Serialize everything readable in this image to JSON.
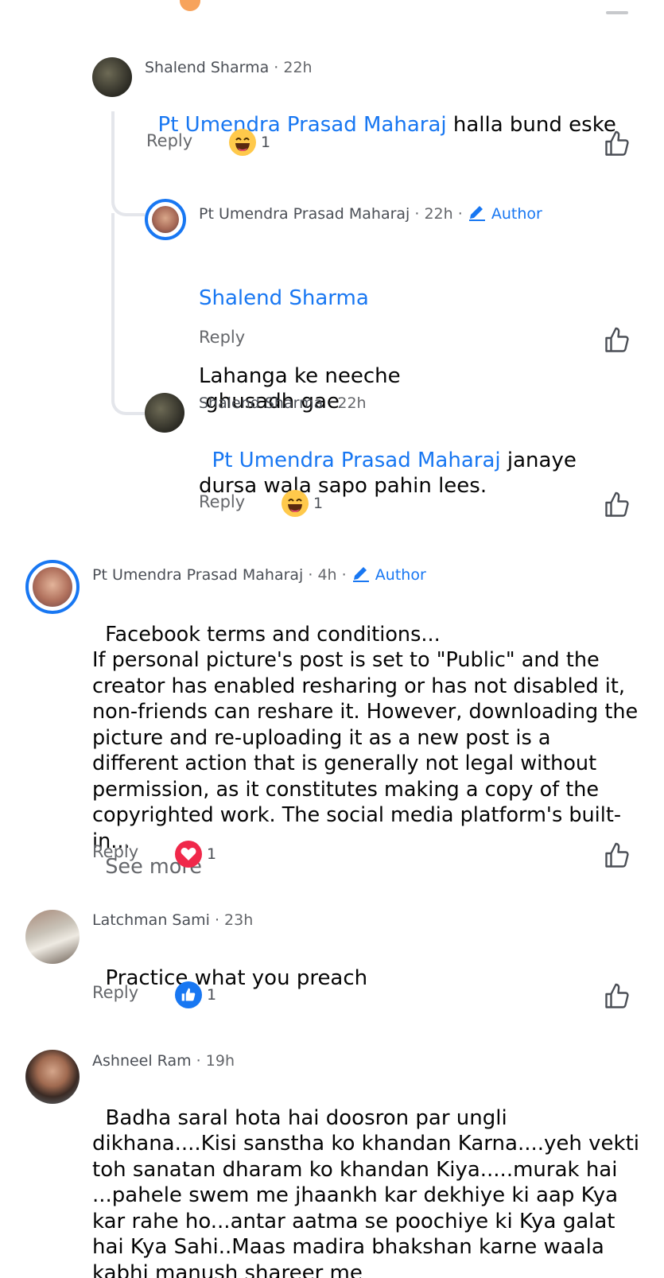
{
  "colors": {
    "accent": "#1877f2",
    "muted": "#65676b",
    "heart": "#f0284a",
    "thread": "#e4e6eb"
  },
  "labels": {
    "reply": "Reply",
    "see_more": "See more",
    "author": "Author",
    "dot": "·"
  },
  "comments": [
    {
      "author": "Shalend Sharma",
      "time": "22h",
      "mention": "Pt Umendra Prasad Maharaj",
      "text": " halla bund eske",
      "reaction": {
        "icon": "haha-emoji-icon",
        "count": "1"
      }
    },
    {
      "author": "Pt Umendra Prasad Maharaj",
      "time": "22h",
      "badge": "Author",
      "mention": "Shalend Sharma",
      "text": "Lahanga ke neeche\n ghusadh gae"
    },
    {
      "author": "Shalend Sharma",
      "time": "22h",
      "mention": "Pt Umendra Prasad Maharaj",
      "text": " janaye dursa wala sapo pahin lees.",
      "reaction": {
        "icon": "haha-emoji-icon",
        "count": "1"
      }
    },
    {
      "author": "Pt Umendra Prasad Maharaj",
      "time": "4h",
      "badge": "Author",
      "text": "Facebook terms and conditions...\nIf personal picture's post is set to \"Public\" and the creator has enabled resharing or has not disabled it, non-friends can reshare it. However, downloading the picture and re-uploading it as a new post is a different action that is generally not legal without permission, as it constitutes making a copy of the copyrighted work. The social media platform's built-in...",
      "reaction": {
        "icon": "love-heart-icon",
        "count": "1"
      }
    },
    {
      "author": "Latchman Sami",
      "time": "23h",
      "text": "Practice what you preach",
      "reaction": {
        "icon": "like-thumb-icon",
        "count": "1"
      }
    },
    {
      "author": "Ashneel Ram",
      "time": "19h",
      "text": "Badha saral hota hai doosron par ungli dikhana....Kisi sanstha ko khandan Karna....yeh vekti toh sanatan dharam ko khandan Kiya.....murak hai ...pahele swem me jhaankh kar dekhiye ki aap Kya kar rahe ho...antar aatma se poochiye ki Kya galat hai Kya Sahi..Maas madira bhakshan karne waala kabhi manush shareer me"
    }
  ]
}
